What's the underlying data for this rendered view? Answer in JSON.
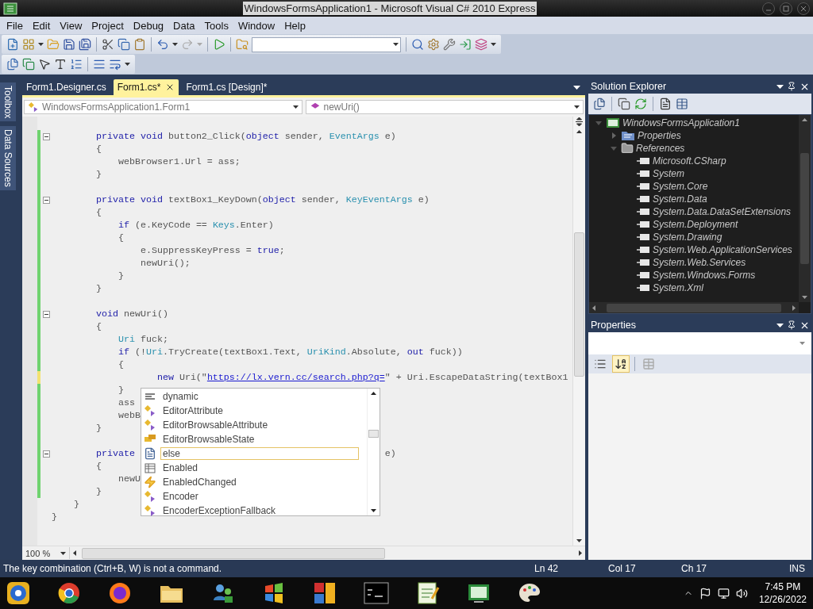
{
  "window": {
    "title": "WindowsFormsApplication1 - Microsoft Visual C# 2010 Express"
  },
  "menu": [
    "File",
    "Edit",
    "View",
    "Project",
    "Debug",
    "Data",
    "Tools",
    "Window",
    "Help"
  ],
  "side_tabs": [
    "Toolbox",
    "Data Sources"
  ],
  "tabs": [
    {
      "label": "Form1.Designer.cs",
      "selected": false
    },
    {
      "label": "Form1.cs*",
      "selected": true
    },
    {
      "label": "Form1.cs [Design]*",
      "selected": false
    }
  ],
  "navigation": {
    "type_dropdown": "WindowsFormsApplication1.Form1",
    "member_dropdown": "newUri()"
  },
  "code_lines": [
    {
      "kind": "blank",
      "changed": false
    },
    {
      "kind": "method",
      "changed": true,
      "saved": true,
      "tokens": [
        {
          "kind": "kw",
          "text": "        private void"
        },
        {
          "kind": "plain",
          "text": " button2_Click("
        },
        {
          "kind": "kw",
          "text": "object"
        },
        {
          "kind": "plain",
          "text": " sender, "
        },
        {
          "kind": "type",
          "text": "EventArgs"
        },
        {
          "kind": "plain",
          "text": " e)"
        }
      ]
    },
    {
      "kind": "code",
      "changed": true,
      "saved": true,
      "tokens": [
        {
          "kind": "plain",
          "text": "        {"
        }
      ]
    },
    {
      "kind": "code",
      "changed": true,
      "saved": true,
      "tokens": [
        {
          "kind": "plain",
          "text": "            webBrowser1.Url = ass;"
        }
      ]
    },
    {
      "kind": "code",
      "changed": true,
      "saved": true,
      "tokens": [
        {
          "kind": "plain",
          "text": "        }"
        }
      ]
    },
    {
      "kind": "blank",
      "changed": true,
      "saved": true
    },
    {
      "kind": "method",
      "changed": true,
      "saved": true,
      "tokens": [
        {
          "kind": "kw",
          "text": "        private void"
        },
        {
          "kind": "plain",
          "text": " textBox1_KeyDown("
        },
        {
          "kind": "kw",
          "text": "object"
        },
        {
          "kind": "plain",
          "text": " sender, "
        },
        {
          "kind": "type",
          "text": "KeyEventArgs"
        },
        {
          "kind": "plain",
          "text": " e)"
        }
      ]
    },
    {
      "kind": "code",
      "changed": true,
      "saved": true,
      "tokens": [
        {
          "kind": "plain",
          "text": "        {"
        }
      ]
    },
    {
      "kind": "code",
      "changed": true,
      "saved": true,
      "tokens": [
        {
          "kind": "kw",
          "text": "            if"
        },
        {
          "kind": "plain",
          "text": " (e.KeyCode == "
        },
        {
          "kind": "type",
          "text": "Keys"
        },
        {
          "kind": "plain",
          "text": ".Enter)"
        }
      ]
    },
    {
      "kind": "code",
      "changed": true,
      "saved": true,
      "tokens": [
        {
          "kind": "plain",
          "text": "            {"
        }
      ]
    },
    {
      "kind": "code",
      "changed": true,
      "saved": true,
      "tokens": [
        {
          "kind": "plain",
          "text": "                e.SuppressKeyPress = "
        },
        {
          "kind": "kw",
          "text": "true"
        },
        {
          "kind": "plain",
          "text": ";"
        }
      ]
    },
    {
      "kind": "code",
      "changed": true,
      "saved": true,
      "tokens": [
        {
          "kind": "plain",
          "text": "                newUri();"
        }
      ]
    },
    {
      "kind": "code",
      "changed": true,
      "saved": true,
      "tokens": [
        {
          "kind": "plain",
          "text": "            }"
        }
      ]
    },
    {
      "kind": "code",
      "changed": true,
      "saved": true,
      "tokens": [
        {
          "kind": "plain",
          "text": "        }"
        }
      ]
    },
    {
      "kind": "blank",
      "changed": true,
      "saved": true
    },
    {
      "kind": "method",
      "changed": true,
      "saved": true,
      "tokens": [
        {
          "kind": "kw",
          "text": "        void"
        },
        {
          "kind": "plain",
          "text": " newUri()"
        }
      ]
    },
    {
      "kind": "code",
      "changed": true,
      "saved": true,
      "tokens": [
        {
          "kind": "plain",
          "text": "        {"
        }
      ]
    },
    {
      "kind": "code",
      "changed": true,
      "saved": true,
      "tokens": [
        {
          "kind": "type",
          "text": "            Uri"
        },
        {
          "kind": "plain",
          "text": " fuck;"
        }
      ]
    },
    {
      "kind": "code",
      "changed": true,
      "saved": true,
      "tokens": [
        {
          "kind": "kw",
          "text": "            if"
        },
        {
          "kind": "plain",
          "text": " (!"
        },
        {
          "kind": "type",
          "text": "Uri"
        },
        {
          "kind": "plain",
          "text": ".TryCreate(textBox1.Text, "
        },
        {
          "kind": "type",
          "text": "UriKind"
        },
        {
          "kind": "plain",
          "text": ".Absolute, "
        },
        {
          "kind": "kw",
          "text": "out"
        },
        {
          "kind": "plain",
          "text": " fuck))"
        }
      ]
    },
    {
      "kind": "code",
      "changed": true,
      "saved": true,
      "tokens": [
        {
          "kind": "plain",
          "text": "            {"
        }
      ]
    },
    {
      "kind": "code",
      "changed": true,
      "saved": false,
      "tokens": [
        {
          "kind": "kw",
          "text": "                   new"
        },
        {
          "kind": "plain",
          "text": " Uri(\""
        },
        {
          "kind": "url",
          "text": "https://lx.vern.cc/search.php?q="
        },
        {
          "kind": "plain",
          "text": "\" + Uri.EscapeDataString(textBox1"
        }
      ]
    },
    {
      "kind": "code",
      "changed": true,
      "saved": true,
      "tokens": [
        {
          "kind": "plain",
          "text": "            }"
        }
      ]
    },
    {
      "kind": "code",
      "changed": true,
      "saved": true,
      "tokens": [
        {
          "kind": "plain",
          "text": "            ass"
        }
      ]
    },
    {
      "kind": "code",
      "changed": true,
      "saved": true,
      "tokens": [
        {
          "kind": "plain",
          "text": "            webB"
        }
      ]
    },
    {
      "kind": "code",
      "changed": true,
      "saved": true,
      "tokens": [
        {
          "kind": "plain",
          "text": "        }"
        }
      ]
    },
    {
      "kind": "blank",
      "changed": true,
      "saved": true
    },
    {
      "kind": "method",
      "changed": true,
      "saved": true,
      "tokens": [
        {
          "kind": "kw",
          "text": "        private"
        }
      ],
      "tail": "                                             e)"
    },
    {
      "kind": "code",
      "changed": true,
      "saved": true,
      "tokens": [
        {
          "kind": "plain",
          "text": "        {"
        }
      ]
    },
    {
      "kind": "code",
      "changed": true,
      "saved": true,
      "tokens": [
        {
          "kind": "plain",
          "text": "            newU"
        }
      ]
    },
    {
      "kind": "code",
      "changed": true,
      "saved": true,
      "tokens": [
        {
          "kind": "plain",
          "text": "        }"
        }
      ]
    },
    {
      "kind": "code",
      "changed": false,
      "tokens": [
        {
          "kind": "plain",
          "text": "    }"
        }
      ]
    },
    {
      "kind": "code",
      "changed": false,
      "tokens": [
        {
          "kind": "plain",
          "text": "}"
        }
      ]
    },
    {
      "kind": "blank",
      "changed": false
    }
  ],
  "completion_list": [
    {
      "label": "dynamic",
      "kind": "keyword",
      "selected": false
    },
    {
      "label": "EditorAttribute",
      "kind": "class",
      "selected": false
    },
    {
      "label": "EditorBrowsableAttribute",
      "kind": "class",
      "selected": false
    },
    {
      "label": "EditorBrowsableState",
      "kind": "enum",
      "selected": false
    },
    {
      "label": "else",
      "kind": "snippet",
      "selected": true
    },
    {
      "label": "Enabled",
      "kind": "property",
      "selected": false
    },
    {
      "label": "EnabledChanged",
      "kind": "event",
      "selected": false
    },
    {
      "label": "Encoder",
      "kind": "class",
      "selected": false
    },
    {
      "label": "EncoderExceptionFallback",
      "kind": "class",
      "selected": false
    }
  ],
  "zoom": "100 %",
  "solution_explorer": {
    "title": "Solution Explorer",
    "tree": [
      {
        "label": "WindowsFormsApplication1",
        "kind": "project",
        "expanded": true,
        "children": [
          {
            "label": "Properties",
            "kind": "properties",
            "expanded": false
          },
          {
            "label": "References",
            "kind": "folder",
            "expanded": true,
            "children": [
              {
                "label": "Microsoft.CSharp",
                "kind": "reference"
              },
              {
                "label": "System",
                "kind": "reference"
              },
              {
                "label": "System.Core",
                "kind": "reference"
              },
              {
                "label": "System.Data",
                "kind": "reference"
              },
              {
                "label": "System.Data.DataSetExtensions",
                "kind": "reference"
              },
              {
                "label": "System.Deployment",
                "kind": "reference"
              },
              {
                "label": "System.Drawing",
                "kind": "reference"
              },
              {
                "label": "System.Web.ApplicationServices",
                "kind": "reference"
              },
              {
                "label": "System.Web.Services",
                "kind": "reference"
              },
              {
                "label": "System.Windows.Forms",
                "kind": "reference"
              },
              {
                "label": "System.Xml",
                "kind": "reference"
              }
            ]
          }
        ]
      }
    ]
  },
  "properties": {
    "title": "Properties"
  },
  "status_bar": {
    "message": "The key combination (Ctrl+B, W) is not a command.",
    "line": "Ln 42",
    "column": "Col 17",
    "char": "Ch 17",
    "mode": "INS"
  },
  "taskbar": {
    "time": "7:45 PM",
    "date": "12/26/2022"
  }
}
